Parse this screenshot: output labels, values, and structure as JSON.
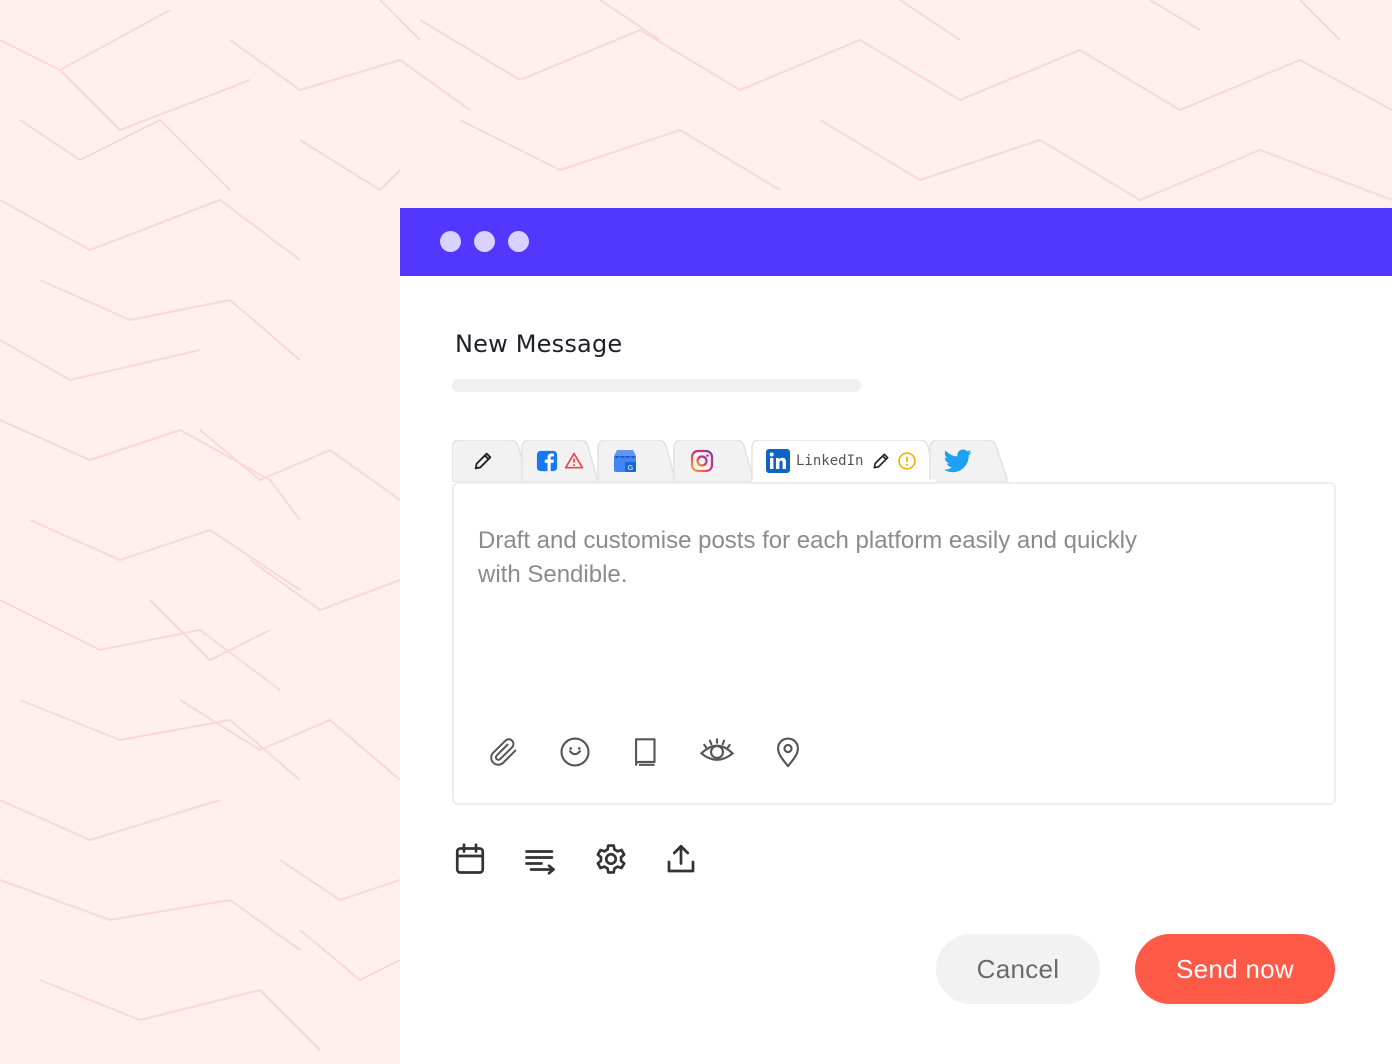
{
  "window": {
    "dots": [
      "window-dot-1",
      "window-dot-2",
      "window-dot-3"
    ],
    "title": "New Message"
  },
  "tabs": [
    {
      "name": "edit-all-tab",
      "icon": "pencil-icon"
    },
    {
      "name": "facebook-tab",
      "icon": "facebook-icon",
      "status_icon": "warning-triangle-icon"
    },
    {
      "name": "google-business-tab",
      "icon": "google-my-business-icon"
    },
    {
      "name": "instagram-tab",
      "icon": "instagram-icon"
    },
    {
      "name": "linkedin-tab",
      "icon": "linkedin-icon",
      "label": "LinkedIn",
      "edit_icon": "pencil-icon",
      "status_icon": "alert-circle-icon",
      "active": true
    },
    {
      "name": "twitter-tab",
      "icon": "twitter-icon"
    }
  ],
  "editor": {
    "placeholder": "Draft and customise posts for each platform easily and quickly with Sendible.",
    "toolbar": [
      "paperclip-icon",
      "emoji-icon",
      "book-icon",
      "eye-icon",
      "location-pin-icon"
    ]
  },
  "bottom_toolbar": [
    "calendar-icon",
    "queue-icon",
    "gear-icon",
    "upload-icon"
  ],
  "actions": {
    "cancel_label": "Cancel",
    "send_label": "Send now"
  },
  "colors": {
    "titlebar": "#5237FF",
    "send_button": "#FF5A47",
    "background": "#FFEFEE",
    "facebook": "#1877F2",
    "linkedin": "#0A66C2",
    "twitter": "#1DA1F2",
    "warning": "#F0B400",
    "error": "#F0434F"
  }
}
